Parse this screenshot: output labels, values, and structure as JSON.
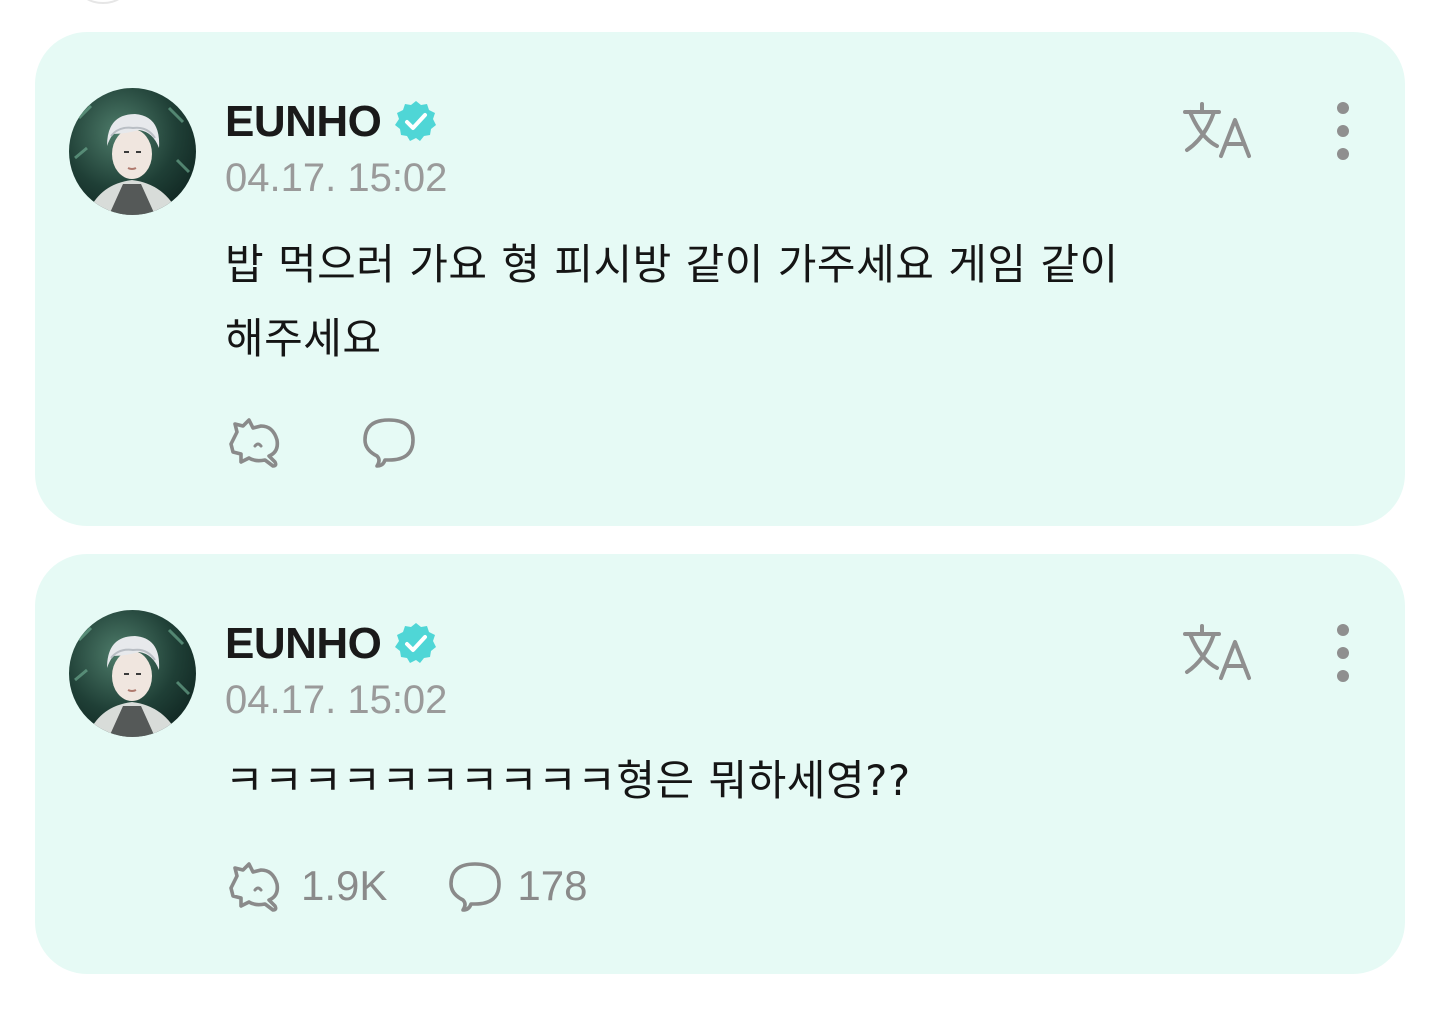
{
  "posts": [
    {
      "author": "EUNHO",
      "verified": true,
      "time": "04.17. 15:02",
      "body_lines": [
        "밥 먹으러 가요 형 피시방 같이 가주세요 게임 같이",
        "해주세요"
      ],
      "reactions": "",
      "comments": ""
    },
    {
      "author": "EUNHO",
      "verified": true,
      "time": "04.17. 15:02",
      "body_lines": [
        "ㅋㅋㅋㅋㅋㅋㅋㅋㅋㅋ형은 뭐하세영??"
      ],
      "reactions": "1.9K",
      "comments": "178"
    }
  ],
  "icons": {
    "verified": "verified-badge-icon",
    "translate": "translate-icon",
    "more": "more-vertical-icon",
    "reaction": "reaction-icon",
    "comment": "comment-bubble-icon"
  },
  "colors": {
    "card_background": "#e6faf5",
    "verified_badge": "#4fd6d6",
    "text_primary": "#151515",
    "text_secondary": "#9a9a9a",
    "icon": "#8a8a8a"
  }
}
